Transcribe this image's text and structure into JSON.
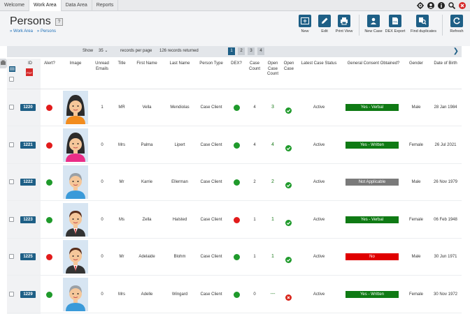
{
  "menu": {
    "items": [
      {
        "label": "Welcome",
        "active": false
      },
      {
        "label": "Work Area",
        "active": true
      },
      {
        "label": "Data Area",
        "active": false
      },
      {
        "label": "Reports",
        "active": false
      }
    ],
    "icons": [
      "gear-icon",
      "user-icon",
      "info-icon",
      "search-icon",
      "close-icon"
    ]
  },
  "header": {
    "title": "Persons",
    "help": "?",
    "breadcrumb": [
      "Work Area",
      "Persons"
    ]
  },
  "toolbar": {
    "new": "New",
    "edit": "Edit",
    "print": "Print View",
    "new_case": "New Case",
    "dex_export": "DEX Export",
    "find_duplicates": "Find duplicates",
    "refresh": "Refresh"
  },
  "pager": {
    "show_label": "Show",
    "per_page_value": "35",
    "per_page_label": "records per page",
    "records": "126 records returned",
    "pages": [
      "1",
      "2",
      "3",
      "4"
    ],
    "current_page": "1"
  },
  "columns": {
    "id": "ID",
    "alert": "Alert?",
    "image": "Image",
    "unread": "Unread Emails",
    "title": "Title",
    "first": "First Name",
    "last": "Last Name",
    "type": "Person Type",
    "dex": "DEX?",
    "case_count": "Case Count",
    "open_case_count": "Open Case Count",
    "open_case": "Open Case",
    "latest_status": "Latest Case Status",
    "consent": "General Consent Obtained?",
    "gender": "Gender",
    "dob": "Date of Birth"
  },
  "rows": [
    {
      "id": "1220",
      "alert": "red",
      "avatar": "female-dark",
      "unread": "1",
      "title": "MR",
      "first": "Vella",
      "last": "Mendiolas",
      "type": "Case Client",
      "dex": "green",
      "case_count": "4",
      "open_case_count": "3",
      "open_case": "yes",
      "latest_status": "Active",
      "consent": "Yes - Verbal",
      "consent_color": "#0f7a14",
      "gender": "Male",
      "dob": "28 Jan 1984"
    },
    {
      "id": "1221",
      "alert": "red",
      "avatar": "female-pink",
      "unread": "0",
      "title": "Mrs",
      "first": "Palma",
      "last": "Lipert",
      "type": "Case Client",
      "dex": "green",
      "case_count": "4",
      "open_case_count": "4",
      "open_case": "yes",
      "latest_status": "Active",
      "consent": "Yes - Written",
      "consent_color": "#0f7a14",
      "gender": "Female",
      "dob": "26 Jul 2021"
    },
    {
      "id": "1222",
      "alert": "green",
      "avatar": "male-grey",
      "unread": "0",
      "title": "Mr",
      "first": "Karrie",
      "last": "Ellerman",
      "type": "Case Client",
      "dex": "green",
      "case_count": "2",
      "open_case_count": "2",
      "open_case": "yes",
      "latest_status": "Active",
      "consent": "Not Applicable",
      "consent_color": "#7a7a7a",
      "gender": "Male",
      "dob": "26 Nov 1979"
    },
    {
      "id": "1223",
      "alert": "green",
      "avatar": "male-suit",
      "unread": "0",
      "title": "Ms",
      "first": "Zella",
      "last": "Halsted",
      "type": "Case Client",
      "dex": "red",
      "case_count": "1",
      "open_case_count": "1",
      "open_case": "yes",
      "latest_status": "Active",
      "consent": "Yes - Verbal",
      "consent_color": "#0f7a14",
      "gender": "Female",
      "dob": "06 Feb 1948"
    },
    {
      "id": "1225",
      "alert": "red",
      "avatar": "male-suit",
      "unread": "0",
      "title": "Mr",
      "first": "Adelaide",
      "last": "Blohm",
      "type": "Case Client",
      "dex": "green",
      "case_count": "1",
      "open_case_count": "1",
      "open_case": "yes",
      "latest_status": "Active",
      "consent": "No",
      "consent_color": "#e00000",
      "gender": "Male",
      "dob": "30 Jun 1971"
    },
    {
      "id": "1229",
      "alert": "green",
      "avatar": "male-grey",
      "unread": "0",
      "title": "Mrs",
      "first": "Adelle",
      "last": "Wingard",
      "type": "Case Client",
      "dex": "green",
      "case_count": "0",
      "open_case_count": "---",
      "open_case": "no",
      "latest_status": "Active",
      "consent": "Yes - Written",
      "consent_color": "#0f7a14",
      "gender": "Female",
      "dob": "30 Nov 1972"
    }
  ],
  "colors": {
    "brand": "#1e5f86",
    "dot_red": "#e21b1b",
    "dot_green": "#1f9a2b",
    "check_green": "#1f9a2b",
    "cross_red": "#d9261c"
  }
}
